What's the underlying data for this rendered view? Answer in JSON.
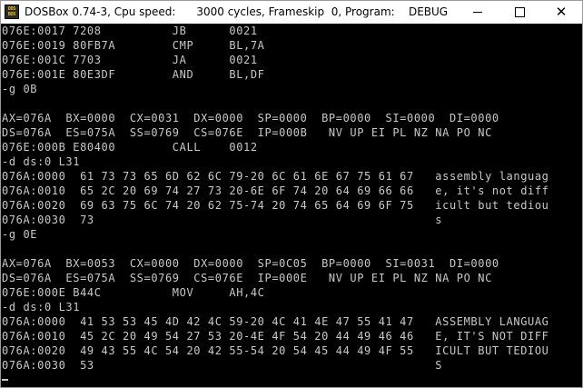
{
  "window": {
    "title": "DOSBox 0.74-3, Cpu speed:      3000 cycles, Frameskip  0, Program:    DEBUG",
    "icon_lines": [
      "DOS",
      "BOX"
    ]
  },
  "terminal": {
    "lines": [
      "076E:0017 7208          JB      0021",
      "076E:0019 80FB7A        CMP     BL,7A",
      "076E:001C 7703          JA      0021",
      "076E:001E 80E3DF        AND     BL,DF",
      "-g 0B",
      "",
      "AX=076A  BX=0000  CX=0031  DX=0000  SP=0000  BP=0000  SI=0000  DI=0000",
      "DS=076A  ES=075A  SS=0769  CS=076E  IP=000B   NV UP EI PL NZ NA PO NC",
      "076E:000B E80400        CALL    0012",
      "-d ds:0 L31",
      "076A:0000  61 73 73 65 6D 62 6C 79-20 6C 61 6E 67 75 61 67   assembly languag",
      "076A:0010  65 2C 20 69 74 27 73 20-6E 6F 74 20 64 69 66 66   e, it's not diff",
      "076A:0020  69 63 75 6C 74 20 62 75-74 20 74 65 64 69 6F 75   icult but tediou",
      "076A:0030  73                                                s",
      "-g 0E",
      "",
      "AX=076A  BX=0053  CX=0000  DX=0000  SP=0C05  BP=0000  SI=0031  DI=0000",
      "DS=076A  ES=075A  SS=0769  CS=076E  IP=000E   NV UP EI PL NZ NA PO NC",
      "076E:000E B44C          MOV     AH,4C",
      "-d ds:0 L31",
      "076A:0000  41 53 53 45 4D 42 4C 59-20 4C 41 4E 47 55 41 47   ASSEMBLY LANGUAG",
      "076A:0010  45 2C 20 49 54 27 53 20-4E 4F 54 20 44 49 46 46   E, IT'S NOT DIFF",
      "076A:0020  49 43 55 4C 54 20 42 55-54 20 54 45 44 49 4F 55   ICULT BUT TEDIOU",
      "076A:0030  53                                                S",
      "-"
    ]
  },
  "icons": {
    "minimize": "minimize-icon",
    "maximize": "maximize-icon",
    "close": "close-icon",
    "close_glyph": "✕"
  },
  "colors": {
    "terminal_bg": "#000000",
    "terminal_text": "#c8c8c8",
    "titlebar_bg": "#ffffff"
  }
}
